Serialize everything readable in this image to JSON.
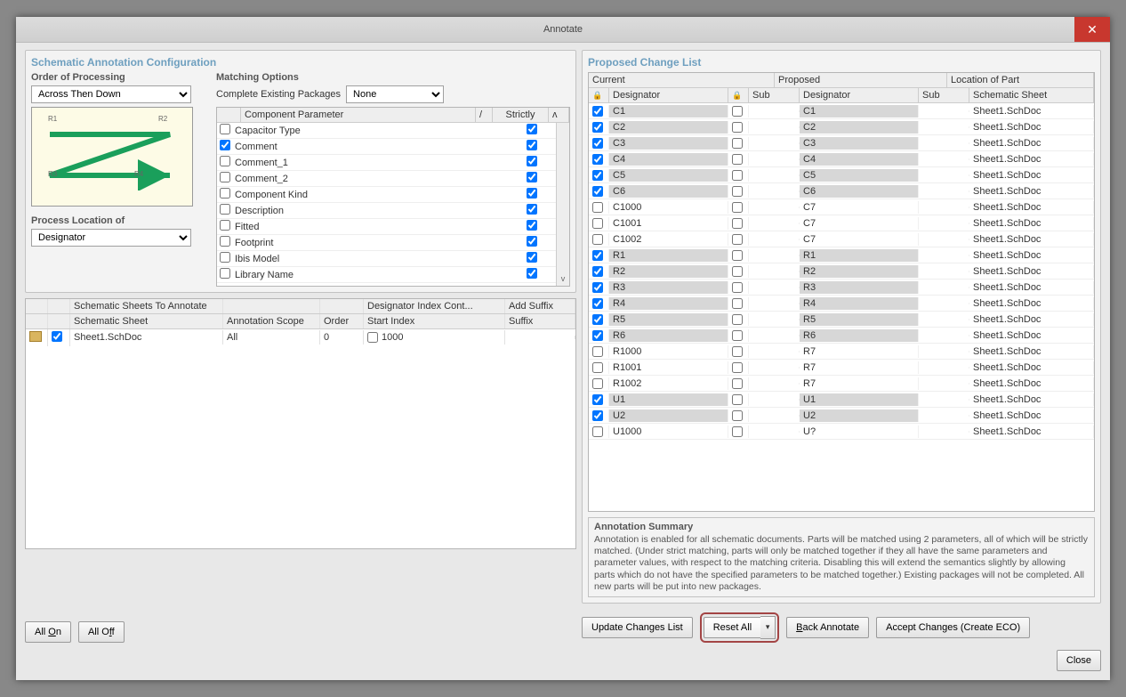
{
  "window": {
    "title": "Annotate"
  },
  "left": {
    "header": "Schematic Annotation Configuration",
    "order_label": "Order of Processing",
    "order_value": "Across Then Down",
    "process_loc_label": "Process Location of",
    "process_loc_value": "Designator",
    "match_label": "Matching Options",
    "complete_label": "Complete Existing Packages",
    "complete_value": "None",
    "param_header_name": "Component Parameter",
    "param_header_strict": "Strictly",
    "params": [
      {
        "name": "Capacitor Type",
        "checked": false,
        "strict": true
      },
      {
        "name": "Comment",
        "checked": true,
        "strict": true
      },
      {
        "name": "Comment_1",
        "checked": false,
        "strict": true
      },
      {
        "name": "Comment_2",
        "checked": false,
        "strict": true
      },
      {
        "name": "Component Kind",
        "checked": false,
        "strict": true
      },
      {
        "name": "Description",
        "checked": false,
        "strict": true
      },
      {
        "name": "Fitted",
        "checked": false,
        "strict": true
      },
      {
        "name": "Footprint",
        "checked": false,
        "strict": true
      },
      {
        "name": "Ibis Model",
        "checked": false,
        "strict": true
      },
      {
        "name": "Library Name",
        "checked": false,
        "strict": true
      }
    ],
    "sheets_header": "Schematic Sheets To Annotate",
    "cols": {
      "sheet": "Schematic Sheet",
      "scope": "Annotation Scope",
      "order": "Order",
      "dic": "Designator Index Cont...",
      "start": "Start Index",
      "suffix": "Add Suffix",
      "suf": "Suffix"
    },
    "sheets": [
      {
        "name": "Sheet1.SchDoc",
        "checked": true,
        "scope": "All",
        "order": "0",
        "start": "1000",
        "suffix": ""
      }
    ],
    "all_on": "All On",
    "all_off": "All Off"
  },
  "right": {
    "header": "Proposed Change List",
    "group_cur": "Current",
    "group_prop": "Proposed",
    "group_loc": "Location of Part",
    "col_des": "Designator",
    "col_sub": "Sub",
    "col_sheet": "Schematic Sheet",
    "rows": [
      {
        "lock": true,
        "cur": "C1",
        "sub": "",
        "prop": "C1",
        "psub": "",
        "sheet": "Sheet1.SchDoc",
        "hl": true
      },
      {
        "lock": true,
        "cur": "C2",
        "sub": "",
        "prop": "C2",
        "psub": "",
        "sheet": "Sheet1.SchDoc",
        "hl": true
      },
      {
        "lock": true,
        "cur": "C3",
        "sub": "",
        "prop": "C3",
        "psub": "",
        "sheet": "Sheet1.SchDoc",
        "hl": true
      },
      {
        "lock": true,
        "cur": "C4",
        "sub": "",
        "prop": "C4",
        "psub": "",
        "sheet": "Sheet1.SchDoc",
        "hl": true
      },
      {
        "lock": true,
        "cur": "C5",
        "sub": "",
        "prop": "C5",
        "psub": "",
        "sheet": "Sheet1.SchDoc",
        "hl": true
      },
      {
        "lock": true,
        "cur": "C6",
        "sub": "",
        "prop": "C6",
        "psub": "",
        "sheet": "Sheet1.SchDoc",
        "hl": true
      },
      {
        "lock": false,
        "cur": "C1000",
        "sub": "",
        "prop": "C7",
        "psub": "",
        "sheet": "Sheet1.SchDoc",
        "hl": false
      },
      {
        "lock": false,
        "cur": "C1001",
        "sub": "",
        "prop": "C7",
        "psub": "",
        "sheet": "Sheet1.SchDoc",
        "hl": false
      },
      {
        "lock": false,
        "cur": "C1002",
        "sub": "",
        "prop": "C7",
        "psub": "",
        "sheet": "Sheet1.SchDoc",
        "hl": false
      },
      {
        "lock": true,
        "cur": "R1",
        "sub": "",
        "prop": "R1",
        "psub": "",
        "sheet": "Sheet1.SchDoc",
        "hl": true
      },
      {
        "lock": true,
        "cur": "R2",
        "sub": "",
        "prop": "R2",
        "psub": "",
        "sheet": "Sheet1.SchDoc",
        "hl": true
      },
      {
        "lock": true,
        "cur": "R3",
        "sub": "",
        "prop": "R3",
        "psub": "",
        "sheet": "Sheet1.SchDoc",
        "hl": true
      },
      {
        "lock": true,
        "cur": "R4",
        "sub": "",
        "prop": "R4",
        "psub": "",
        "sheet": "Sheet1.SchDoc",
        "hl": true
      },
      {
        "lock": true,
        "cur": "R5",
        "sub": "",
        "prop": "R5",
        "psub": "",
        "sheet": "Sheet1.SchDoc",
        "hl": true
      },
      {
        "lock": true,
        "cur": "R6",
        "sub": "",
        "prop": "R6",
        "psub": "",
        "sheet": "Sheet1.SchDoc",
        "hl": true
      },
      {
        "lock": false,
        "cur": "R1000",
        "sub": "",
        "prop": "R7",
        "psub": "",
        "sheet": "Sheet1.SchDoc",
        "hl": false
      },
      {
        "lock": false,
        "cur": "R1001",
        "sub": "",
        "prop": "R7",
        "psub": "",
        "sheet": "Sheet1.SchDoc",
        "hl": false
      },
      {
        "lock": false,
        "cur": "R1002",
        "sub": "",
        "prop": "R7",
        "psub": "",
        "sheet": "Sheet1.SchDoc",
        "hl": false
      },
      {
        "lock": true,
        "cur": "U1",
        "sub": "",
        "prop": "U1",
        "psub": "",
        "sheet": "Sheet1.SchDoc",
        "hl": true
      },
      {
        "lock": true,
        "cur": "U2",
        "sub": "",
        "prop": "U2",
        "psub": "",
        "sheet": "Sheet1.SchDoc",
        "hl": true
      },
      {
        "lock": false,
        "cur": "U1000",
        "sub": "",
        "prop": "U?",
        "psub": "",
        "sheet": "Sheet1.SchDoc",
        "hl": false
      }
    ],
    "summary_title": "Annotation Summary",
    "summary_text": "Annotation is enabled for all schematic documents. Parts will be matched using 2 parameters, all of which will be strictly matched. (Under strict matching, parts will only be matched together if they all have the same parameters and parameter values, with respect to the matching criteria. Disabling this will extend the semantics slightly by allowing parts which do not have the specified parameters to be matched together.) Existing packages will not be completed. All new parts will be put into new packages."
  },
  "buttons": {
    "update": "Update Changes List",
    "reset": "Reset All",
    "back": "Back Annotate",
    "accept": "Accept Changes (Create ECO)",
    "close": "Close"
  },
  "preview": {
    "r1": "R1",
    "r2": "R2",
    "r3": "R3",
    "r4": "R4"
  }
}
